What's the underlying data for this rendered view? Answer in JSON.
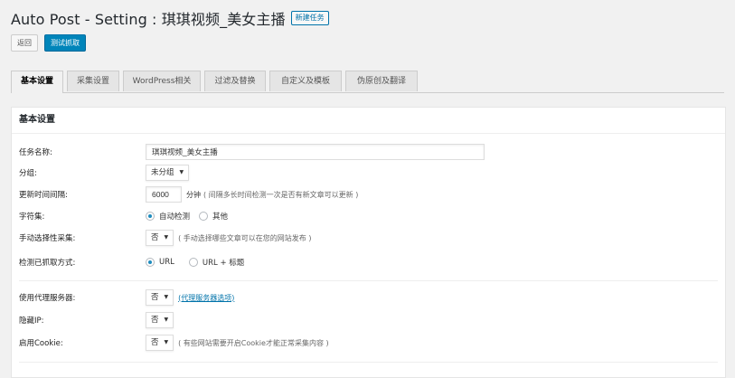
{
  "header": {
    "title": "Auto Post - Setting : 琪琪视频_美女主播",
    "add_new": "新建任务"
  },
  "buttons": {
    "back": "返回",
    "test_fetch": "测试抓取"
  },
  "tabs": [
    {
      "label": "基本设置",
      "active": true
    },
    {
      "label": "采集设置",
      "active": false
    },
    {
      "label": "WordPress相关",
      "active": false
    },
    {
      "label": "过滤及替换",
      "active": false
    },
    {
      "label": "自定义及模板",
      "active": false
    },
    {
      "label": "伪原创及翻译",
      "active": false
    }
  ],
  "panel": {
    "title": "基本设置",
    "task_name": {
      "label": "任务名称:",
      "value": "琪琪视频_美女主播"
    },
    "group": {
      "label": "分组:",
      "value": "未分组"
    },
    "interval": {
      "label": "更新时间间隔:",
      "value": "6000",
      "unit": "分钟",
      "hint": "( 间隔多长时间检测一次是否有新文章可以更新 )"
    },
    "charset": {
      "label": "字符集:",
      "options": [
        "自动检测",
        "其他"
      ],
      "selected": "自动检测"
    },
    "manual_select": {
      "label": "手动选择性采集:",
      "value": "否",
      "hint": "( 手动选择哪些文章可以在您的网站发布 )"
    },
    "detect_method": {
      "label": "检测已抓取方式:",
      "options": [
        "URL",
        "URL + 标题"
      ],
      "selected": "URL"
    },
    "proxy": {
      "label": "使用代理服务器:",
      "value": "否",
      "link": "(代理服务器选项)"
    },
    "hide_ip": {
      "label": "隐藏IP:",
      "value": "否"
    },
    "cookie": {
      "label": "启用Cookie:",
      "value": "否",
      "hint": "( 有些网站需要开启Cookie才能正常采集内容 )"
    }
  }
}
